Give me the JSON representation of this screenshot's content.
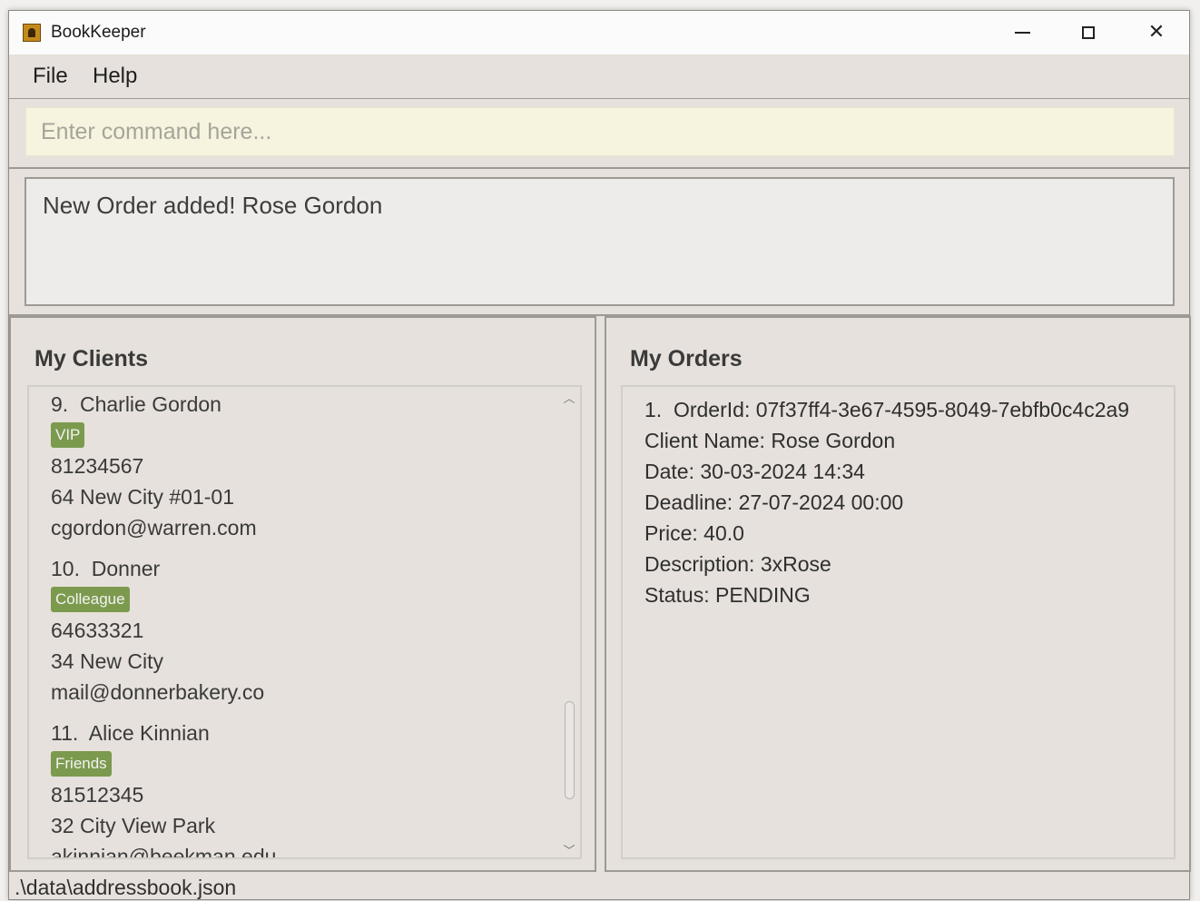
{
  "window": {
    "title": "BookKeeper"
  },
  "menu": {
    "file": "File",
    "help": "Help"
  },
  "command": {
    "placeholder": "Enter command here...",
    "value": ""
  },
  "result": {
    "message": "New Order added! Rose Gordon"
  },
  "clients": {
    "title": "My Clients",
    "items": [
      {
        "index": "9.",
        "name": "Charlie Gordon",
        "tag": "VIP",
        "phone": "81234567",
        "address": "64 New City #01-01",
        "email": "cgordon@warren.com"
      },
      {
        "index": "10.",
        "name": "Donner",
        "tag": "Colleague",
        "phone": "64633321",
        "address": "34 New City",
        "email": "mail@donnerbakery.co"
      },
      {
        "index": "11.",
        "name": "Alice Kinnian",
        "tag": "Friends",
        "phone": "81512345",
        "address": "32 City View Park",
        "email": "akinnian@beekman.edu"
      }
    ]
  },
  "orders": {
    "title": "My Orders",
    "items": [
      {
        "index": "1.",
        "order_id": "OrderId: 07f37ff4-3e67-4595-8049-7ebfb0c4c2a9",
        "client_name": "Client Name: Rose Gordon",
        "date": "Date: 30-03-2024 14:34",
        "deadline": "Deadline: 27-07-2024 00:00",
        "price": "Price: 40.0",
        "description": "Description: 3xRose",
        "status": "Status: PENDING"
      }
    ]
  },
  "status_bar": {
    "path": ".\\data\\addressbook.json"
  },
  "colors": {
    "tag": "#7c9a4e",
    "command_bg": "#f6f4de",
    "panel_bg": "#e6e1dc"
  }
}
